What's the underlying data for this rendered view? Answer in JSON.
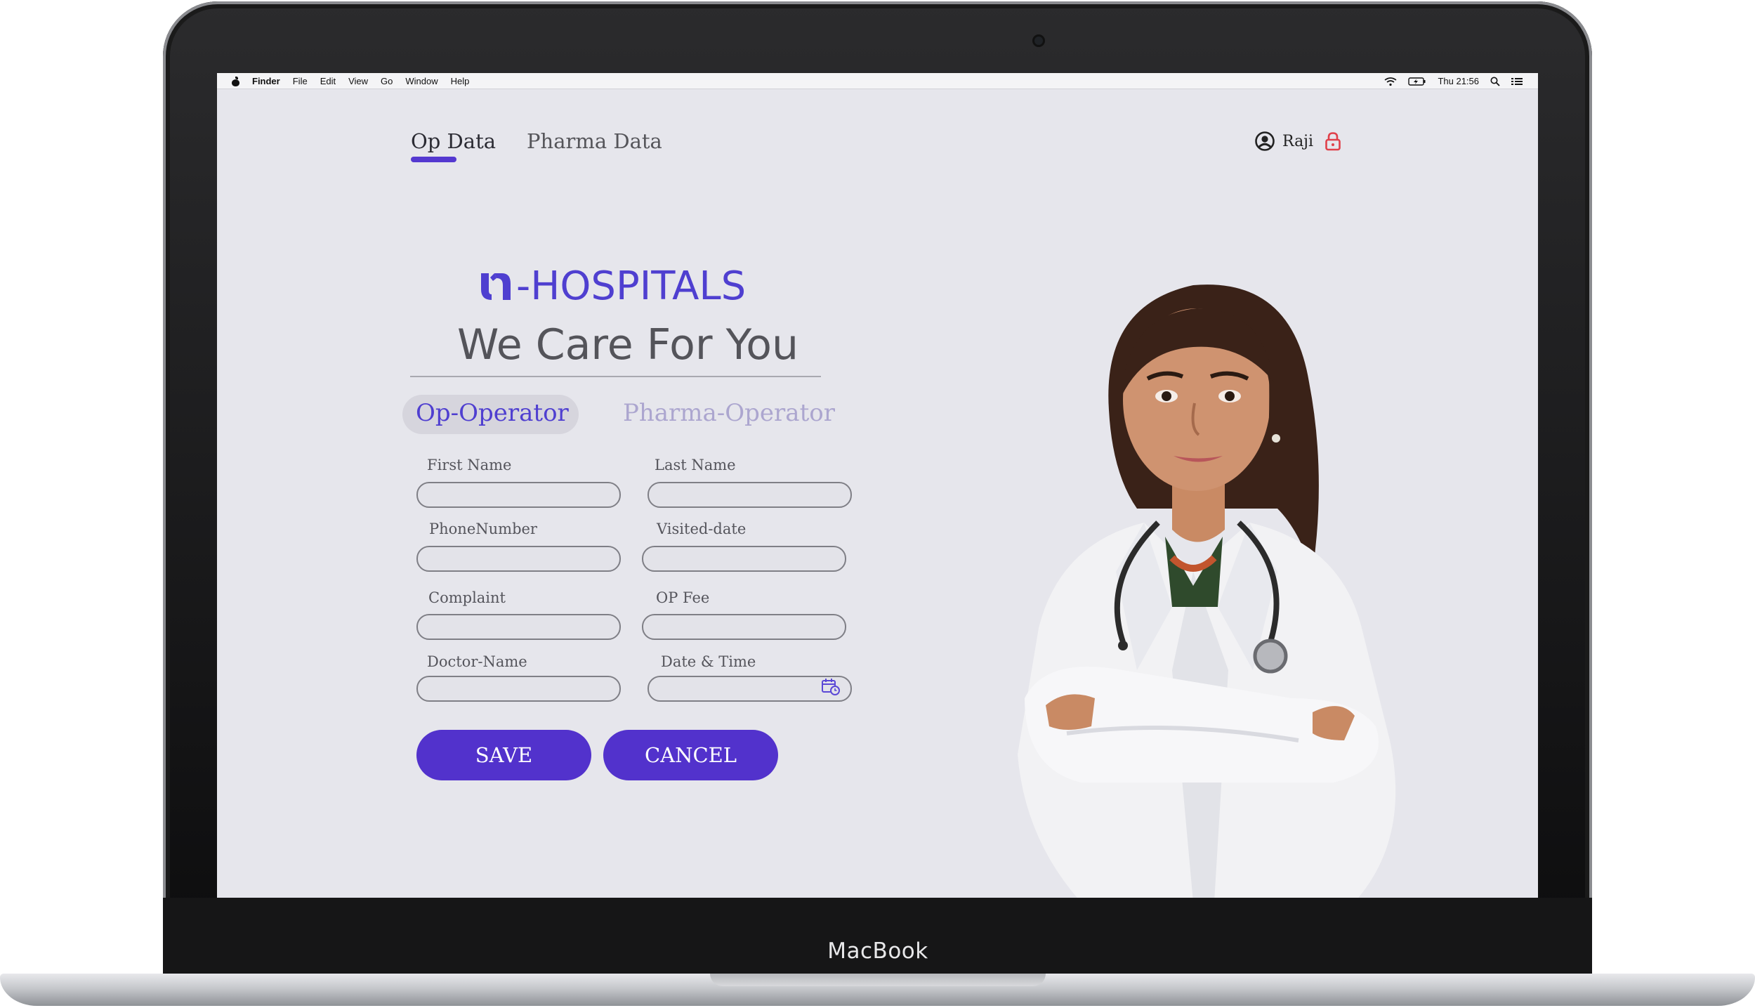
{
  "device": {
    "brand_label": "MacBook"
  },
  "menubar": {
    "app_name": "Finder",
    "items": [
      "File",
      "Edit",
      "View",
      "Go",
      "Window",
      "Help"
    ],
    "clock": "Thu 21:56"
  },
  "nav": {
    "tabs": [
      {
        "label": "Op Data",
        "active": true
      },
      {
        "label": "Pharma Data",
        "active": false
      }
    ],
    "user_name": "Raji"
  },
  "brand": {
    "logo_text": "-HOSPITALS",
    "tagline": "We Care For You",
    "accent_color": "#5232cc"
  },
  "roles": {
    "active": "Op-Operator",
    "inactive": "Pharma-Operator"
  },
  "form": {
    "first_name_label": "First Name",
    "last_name_label": "Last Name",
    "phone_label": "PhoneNumber",
    "visited_date_label": "Visited-date",
    "complaint_label": "Complaint",
    "op_fee_label": "OP Fee",
    "doctor_name_label": "Doctor-Name",
    "date_time_label": "Date & Time",
    "values": {
      "first_name": "",
      "last_name": "",
      "phone": "",
      "visited_date": "",
      "complaint": "",
      "op_fee": "",
      "doctor_name": "",
      "date_time": ""
    }
  },
  "actions": {
    "save": "SAVE",
    "cancel": "CANCEL"
  },
  "icons": {
    "user": "user-circle-icon",
    "lock": "lock-icon",
    "calendar": "calendar-clock-icon",
    "wifi": "wifi-icon",
    "battery": "battery-icon",
    "search": "search-icon",
    "menu": "list-icon"
  },
  "colors": {
    "lock": "#e0404a",
    "screen_bg": "#e6e6ec",
    "inactive_role": "#aca6cf"
  }
}
